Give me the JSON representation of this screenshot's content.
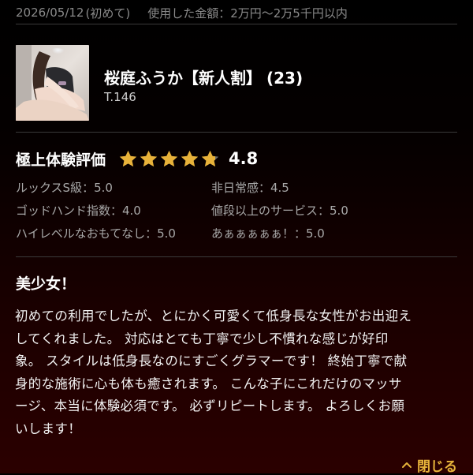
{
  "meta": {
    "visit_date": "2026/05/12",
    "visit_type": "(初めて)",
    "spent_label": "使用した金額：2万円〜2万5千円以内"
  },
  "profile": {
    "name": "桜庭ふうか【新人割】",
    "age": "(23)",
    "height": "T.146"
  },
  "rating": {
    "title": "極上体験評価",
    "score": "4.8",
    "stars_value": 4.8,
    "star_color": "#e8b23a",
    "star_empty_color": "#6f6f6f",
    "sub_ratings": [
      "ルックスS級：5.0",
      "非日常感：4.5",
      "ゴッドハンド指数：4.0",
      "値段以上のサービス：5.0",
      "ハイレベルなおもてなし：5.0",
      "あぁぁぁぁぁ！：5.0"
    ]
  },
  "review": {
    "title": "美少女！",
    "lines": [
      "初めての利用でしたが、とにかく可愛くて低身長な女性がお出迎え",
      "してくれました。 対応はとても丁寧で少し不慣れな感じが好印",
      "象。 スタイルは低身長なのにすごくグラマーです！ 終始丁寧で献",
      "身的な施術に心も体も癒されます。 こんな子にこれだけのマッサ",
      "ージ、本当に体験必須です。 必ずリピートします。 よろしくお願",
      "いします！"
    ]
  },
  "actions": {
    "close_label": "閉じる",
    "accent_color": "#e6b33a"
  },
  "icons": {
    "close_chevron": "chevron-up-icon",
    "star": "star-icon",
    "avatar": "avatar-photo"
  }
}
